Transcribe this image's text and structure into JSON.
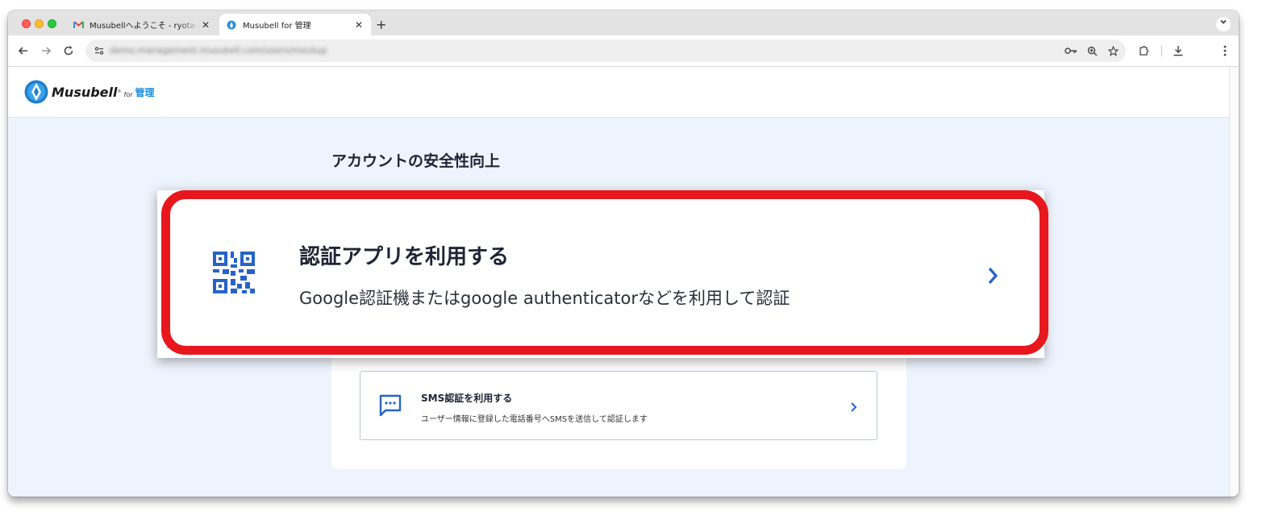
{
  "browser": {
    "tabs": [
      {
        "title": "Musubellへようこそ - ryota-ujita",
        "favicon": "gmail-icon",
        "active": false
      },
      {
        "title": "Musubell for 管理",
        "favicon": "musubell-icon",
        "active": true
      }
    ],
    "new_tab": "+",
    "tab_menu": "⌄",
    "url": "demo.management.musubell.com/users/mockup"
  },
  "header": {
    "logo_word": "Musubell",
    "logo_reg": "®",
    "logo_for": "for",
    "logo_kanri": "管理"
  },
  "main": {
    "title": "アカウントの安全性向上",
    "options": [
      {
        "title": "認証アプリを利用する",
        "desc": "Google認証機またはgoogle authenticatorなどを利用して認証",
        "icon": "qr-code-icon"
      },
      {
        "title": "SMS認証を利用する",
        "desc": "ユーザー情報に登録した電話番号へSMSを送信して認証します",
        "icon": "sms-chat-icon"
      }
    ]
  },
  "colors": {
    "accent": "#2563c9",
    "highlight": "#e8171d",
    "page_bg": "#eef4fd"
  }
}
